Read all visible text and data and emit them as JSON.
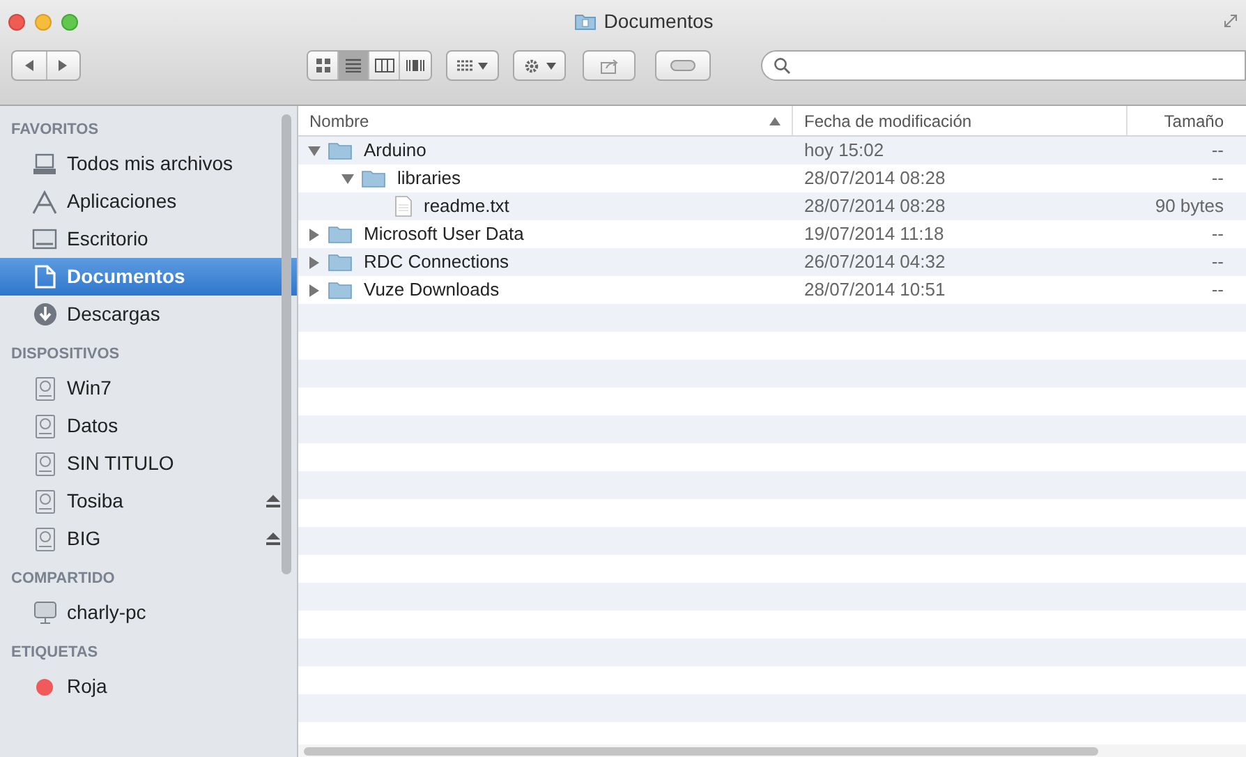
{
  "window": {
    "title": "Documentos"
  },
  "toolbar": {
    "view_buttons": [
      {
        "kind": "icons",
        "selected": false
      },
      {
        "kind": "list",
        "selected": true
      },
      {
        "kind": "columns",
        "selected": false
      },
      {
        "kind": "coverflow",
        "selected": false
      }
    ]
  },
  "sidebar": {
    "sections": [
      {
        "title": "FAVORITOS",
        "items": [
          {
            "label": "Todos mis archivos",
            "kind": "all-files",
            "selected": false
          },
          {
            "label": "Aplicaciones",
            "kind": "apps",
            "selected": false
          },
          {
            "label": "Escritorio",
            "kind": "desktop",
            "selected": false
          },
          {
            "label": "Documentos",
            "kind": "documents",
            "selected": true
          },
          {
            "label": "Descargas",
            "kind": "downloads",
            "selected": false
          }
        ]
      },
      {
        "title": "DISPOSITIVOS",
        "items": [
          {
            "label": "Win7",
            "kind": "disk",
            "selected": false,
            "ejectable": false
          },
          {
            "label": "Datos",
            "kind": "disk",
            "selected": false,
            "ejectable": false
          },
          {
            "label": "SIN TITULO",
            "kind": "disk",
            "selected": false,
            "ejectable": false
          },
          {
            "label": "Tosiba",
            "kind": "disk",
            "selected": false,
            "ejectable": true
          },
          {
            "label": "BIG",
            "kind": "disk",
            "selected": false,
            "ejectable": true
          }
        ]
      },
      {
        "title": "COMPARTIDO",
        "items": [
          {
            "label": "charly-pc",
            "kind": "network",
            "selected": false
          }
        ]
      },
      {
        "title": "ETIQUETAS",
        "items": [
          {
            "label": "Roja",
            "kind": "tag",
            "selected": false,
            "color": "#f05a5a"
          }
        ]
      }
    ]
  },
  "table": {
    "columns": [
      {
        "label": "Nombre",
        "sorted": true
      },
      {
        "label": "Fecha de modificación",
        "sorted": false
      },
      {
        "label": "Tamaño",
        "sorted": false
      }
    ],
    "rows": [
      {
        "name": "Arduino",
        "kind": "folder",
        "date": "hoy 15:02",
        "size": "--",
        "expanded": true,
        "children": [
          {
            "name": "libraries",
            "kind": "folder",
            "date": "28/07/2014 08:28",
            "size": "--",
            "expanded": true,
            "children": [
              {
                "name": "readme.txt",
                "kind": "file",
                "date": "28/07/2014 08:28",
                "size": "90 bytes"
              }
            ]
          }
        ]
      },
      {
        "name": "Microsoft User Data",
        "kind": "folder",
        "date": "19/07/2014 11:18",
        "size": "--",
        "expanded": false
      },
      {
        "name": "RDC Connections",
        "kind": "folder",
        "date": "26/07/2014 04:32",
        "size": "--",
        "expanded": false
      },
      {
        "name": "Vuze Downloads",
        "kind": "folder",
        "date": "28/07/2014 10:51",
        "size": "--",
        "expanded": false
      }
    ]
  }
}
